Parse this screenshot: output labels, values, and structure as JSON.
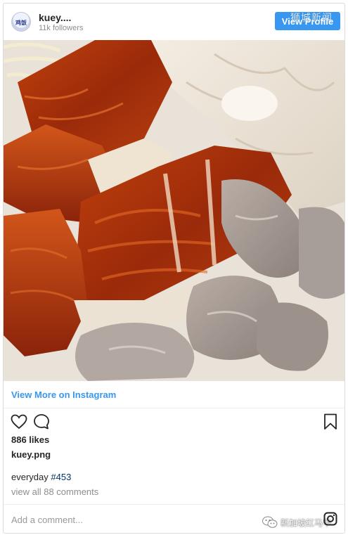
{
  "header": {
    "avatar_text": "鸡饭",
    "username": "kuey....",
    "followers": "11k followers",
    "view_profile_label": "View Profile",
    "watermark": "狮城新闻"
  },
  "post": {
    "image_alt": "Roast chicken with crispy glazed skin, sliced white chicken and gizzards",
    "view_more_label": "View More on Instagram",
    "likes": "886 likes",
    "caption_user": "kuey.png",
    "caption_text": "everyday",
    "caption_hashtag": "#453",
    "comments_link": "view all 88 comments",
    "comment_placeholder": "Add a comment..."
  },
  "footer": {
    "wechat_label": "新加坡红马甲"
  },
  "icons": {
    "like": "heart-icon",
    "comment": "comment-bubble-icon",
    "save": "bookmark-icon",
    "instagram": "instagram-icon",
    "wechat": "wechat-icon"
  },
  "colors": {
    "accent": "#3897f0",
    "hashtag": "#003569",
    "muted": "#8e8e8e"
  }
}
